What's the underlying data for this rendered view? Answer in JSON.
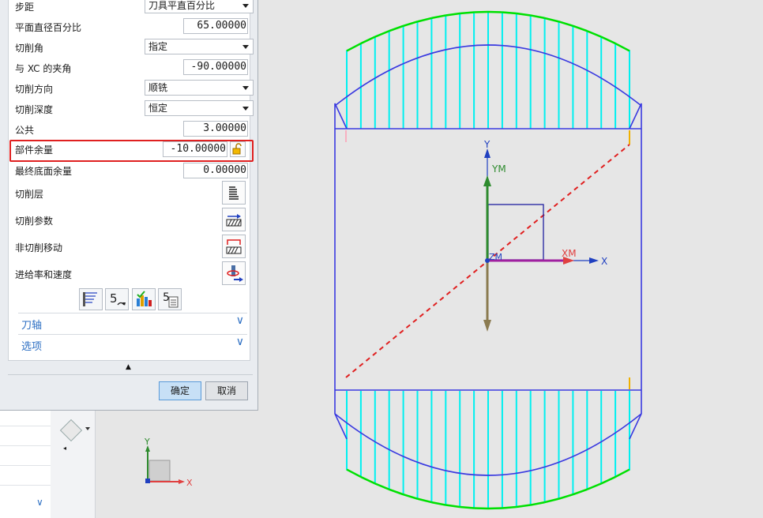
{
  "dialog": {
    "rows": [
      {
        "label": "步距",
        "value": "刀具平直百分比",
        "kind": "select"
      },
      {
        "label": "平面直径百分比",
        "value": "65.00000",
        "kind": "number"
      },
      {
        "label": "切削角",
        "value": "指定",
        "kind": "select"
      },
      {
        "label": "与 XC 的夹角",
        "value": "-90.00000",
        "kind": "number"
      },
      {
        "label": "切削方向",
        "value": "顺铣",
        "kind": "select"
      },
      {
        "label": "切削深度",
        "value": "恒定",
        "kind": "select"
      },
      {
        "label": "公共",
        "value": "3.00000",
        "kind": "number"
      },
      {
        "label": "部件余量",
        "value": "-10.00000",
        "kind": "number"
      },
      {
        "label": "最终底面余量",
        "value": "0.00000",
        "kind": "number"
      }
    ],
    "icon_rows": [
      {
        "label": "切削层",
        "icon": "cut-levels-icon"
      },
      {
        "label": "切削参数",
        "icon": "cut-parameters-icon"
      },
      {
        "label": "非切削移动",
        "icon": "non-cutting-moves-icon"
      },
      {
        "label": "进给率和速度",
        "icon": "feeds-speeds-icon"
      }
    ],
    "sections": [
      {
        "label": "刀轴",
        "chevron": "∨"
      },
      {
        "label": "选项",
        "chevron": "∨"
      }
    ],
    "ok_label": "确定",
    "cancel_label": "取消",
    "collapse_glyph": "▲"
  },
  "viewport": {
    "axis_labels": {
      "x": "X",
      "y": "Y",
      "xm": "XM",
      "ym": "YM",
      "zm": "ZM"
    },
    "triad_labels": {
      "x": "X",
      "y": "Y"
    }
  },
  "colors": {
    "accent": "#2d6fc3",
    "toolpath": "#00f0f0",
    "toolpath_end": "#00e000",
    "boundary": "#3a3ae0",
    "highlight": "#e02020"
  }
}
